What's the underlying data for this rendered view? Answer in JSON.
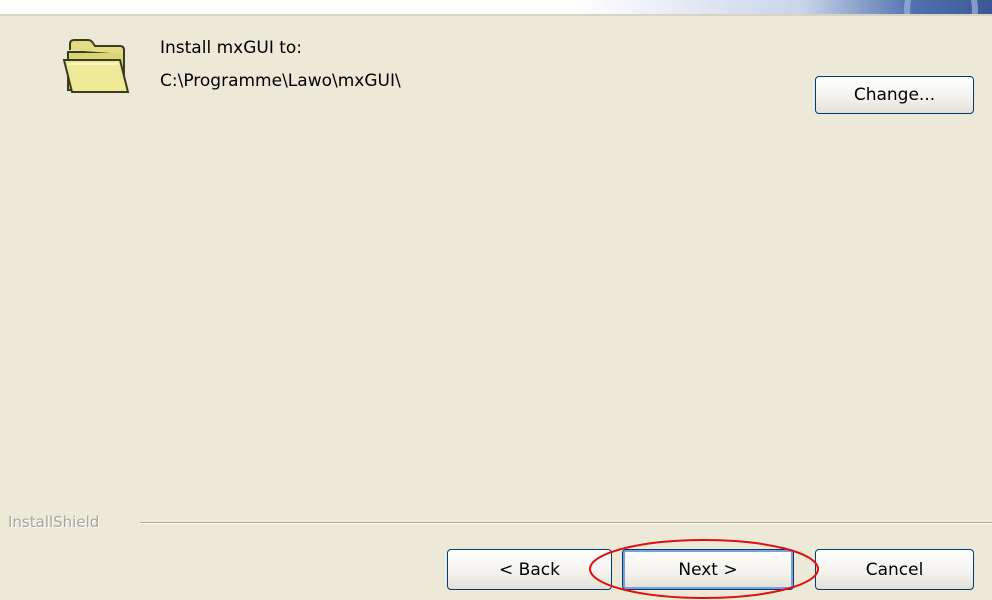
{
  "destination": {
    "label": "Install mxGUI to:",
    "path": "C:\\Programme\\Lawo\\mxGUI\\",
    "icon": "folder-icon",
    "change_label": "Change..."
  },
  "footer": {
    "brand": "InstallShield",
    "back_label": "< Back",
    "next_label": "Next >",
    "cancel_label": "Cancel"
  },
  "colors": {
    "background": "#ece9d8",
    "button_border": "#003c74",
    "annotation": "#e01010",
    "folder": "#e8e48a"
  }
}
